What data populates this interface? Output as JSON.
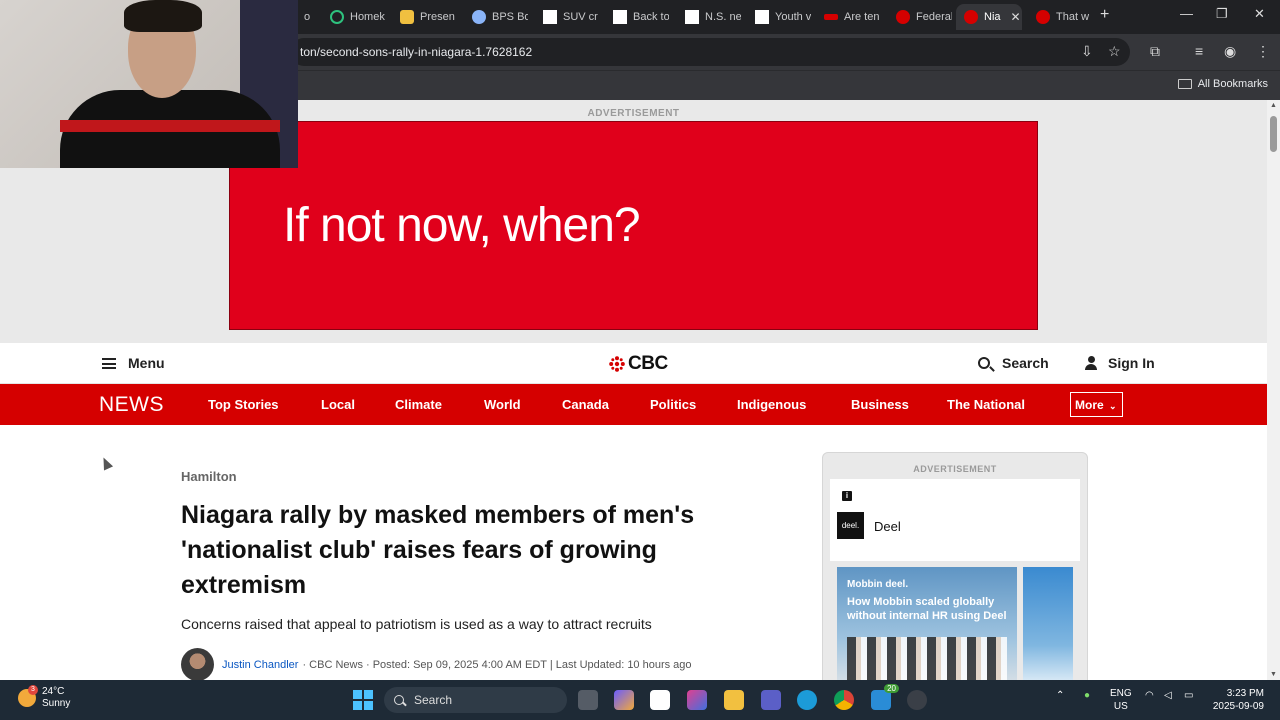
{
  "browser": {
    "tabs": [
      {
        "label": "o"
      },
      {
        "label": "Homek"
      },
      {
        "label": "Presen"
      },
      {
        "label": "BPS Bo"
      },
      {
        "label": "SUV cr"
      },
      {
        "label": "Back to"
      },
      {
        "label": "N.S. ne"
      },
      {
        "label": "Youth v"
      },
      {
        "label": "Are ten"
      },
      {
        "label": "Federal"
      },
      {
        "label": "Nia"
      },
      {
        "label": "That w"
      }
    ],
    "url": "ton/second-sons-rally-in-niagara-1.7628162",
    "all_bookmarks": "All Bookmarks"
  },
  "ad": {
    "label": "ADVERTISEMENT",
    "banner_text": "If not now, when?"
  },
  "header": {
    "menu_label": "Menu",
    "logo_text": "CBC",
    "search_label": "Search",
    "signin_label": "Sign In"
  },
  "nav": {
    "brand": "NEWS",
    "items": [
      "Top Stories",
      "Local",
      "Climate",
      "World",
      "Canada",
      "Politics",
      "Indigenous",
      "Business",
      "The National"
    ],
    "more_label": "More"
  },
  "article": {
    "section": "Hamilton",
    "headline": "Niagara rally by masked members of men's 'nationalist club' raises fears of growing extremism",
    "deck": "Concerns raised that appeal to patriotism is used as a way to attract recruits",
    "author": "Justin Chandler",
    "meta": "· CBC News · Posted: Sep 09, 2025 4:00 AM EDT | Last Updated: 10 hours ago"
  },
  "sidead": {
    "label": "ADVERTISEMENT",
    "info": "i",
    "logo": "deel.",
    "advertiser": "Deel",
    "tile_brand": "Mobbin  deel.",
    "tile_text": "How Mobbin scaled globally without internal HR using Deel"
  },
  "taskbar": {
    "temp": "24°C",
    "condition": "Sunny",
    "weather_badge": "3",
    "search_label": "Search",
    "chrome_badge": "20",
    "lang_top": "ENG",
    "lang_bottom": "US",
    "time": "3:23 PM",
    "date": "2025-09-09"
  },
  "colors": {
    "cbc_red": "#d50000",
    "ad_red": "#e0001b",
    "link_blue": "#0a57c2"
  }
}
